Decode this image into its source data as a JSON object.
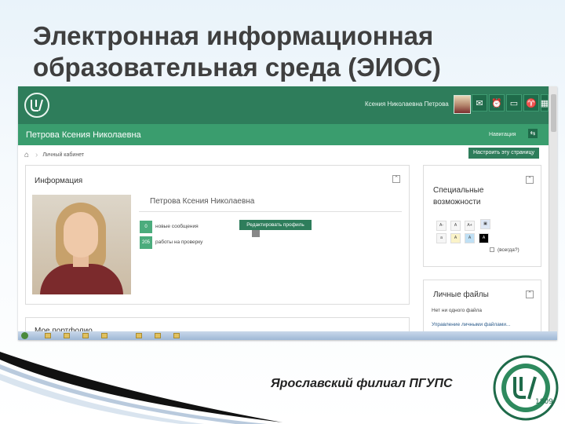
{
  "slide": {
    "title_line1": "Электронная информационная",
    "title_line2": "образовательная среда (ЭИОС)",
    "branch": "Ярославский филиал ПГУПС",
    "seal_text": "1809"
  },
  "colors": {
    "topbar": "#2e7d5b",
    "subbar": "#3a9d6e",
    "badge": "#4bac7d",
    "button": "#2e7d5b"
  },
  "header": {
    "user_name": "Ксения Николаевна Петрова",
    "page_heading": "Петрова Ксения Николаевна",
    "navigation": "Навигация",
    "icons": [
      "messages-icon",
      "calendar-icon",
      "chat-icon",
      "trophy-icon",
      "grid-icon"
    ]
  },
  "breadcrumb": {
    "current": "Личный кабинет"
  },
  "customize_button": "Настроить эту страницу",
  "info_block": {
    "title": "Информация",
    "profile_name": "Петрова Ксения Николаевна",
    "stats": [
      {
        "count": "0",
        "label": "новые сообщения"
      },
      {
        "count": "205",
        "label": "работы на проверку"
      }
    ],
    "edit_button": "Редактировать профиль"
  },
  "accessibility": {
    "title_line1": "Специальные",
    "title_line2": "возможности",
    "buttons_row1": [
      "A-",
      "A",
      "A+"
    ],
    "buttons_row2": [
      "a",
      "A",
      "A",
      "A"
    ],
    "always_label": "(всегда?)"
  },
  "files_block": {
    "title": "Личные файлы",
    "empty_text": "Нет ни одного файла",
    "manage_link": "Управление личными файлами..."
  },
  "portfolio_block": {
    "title": "Мое портфолио"
  }
}
